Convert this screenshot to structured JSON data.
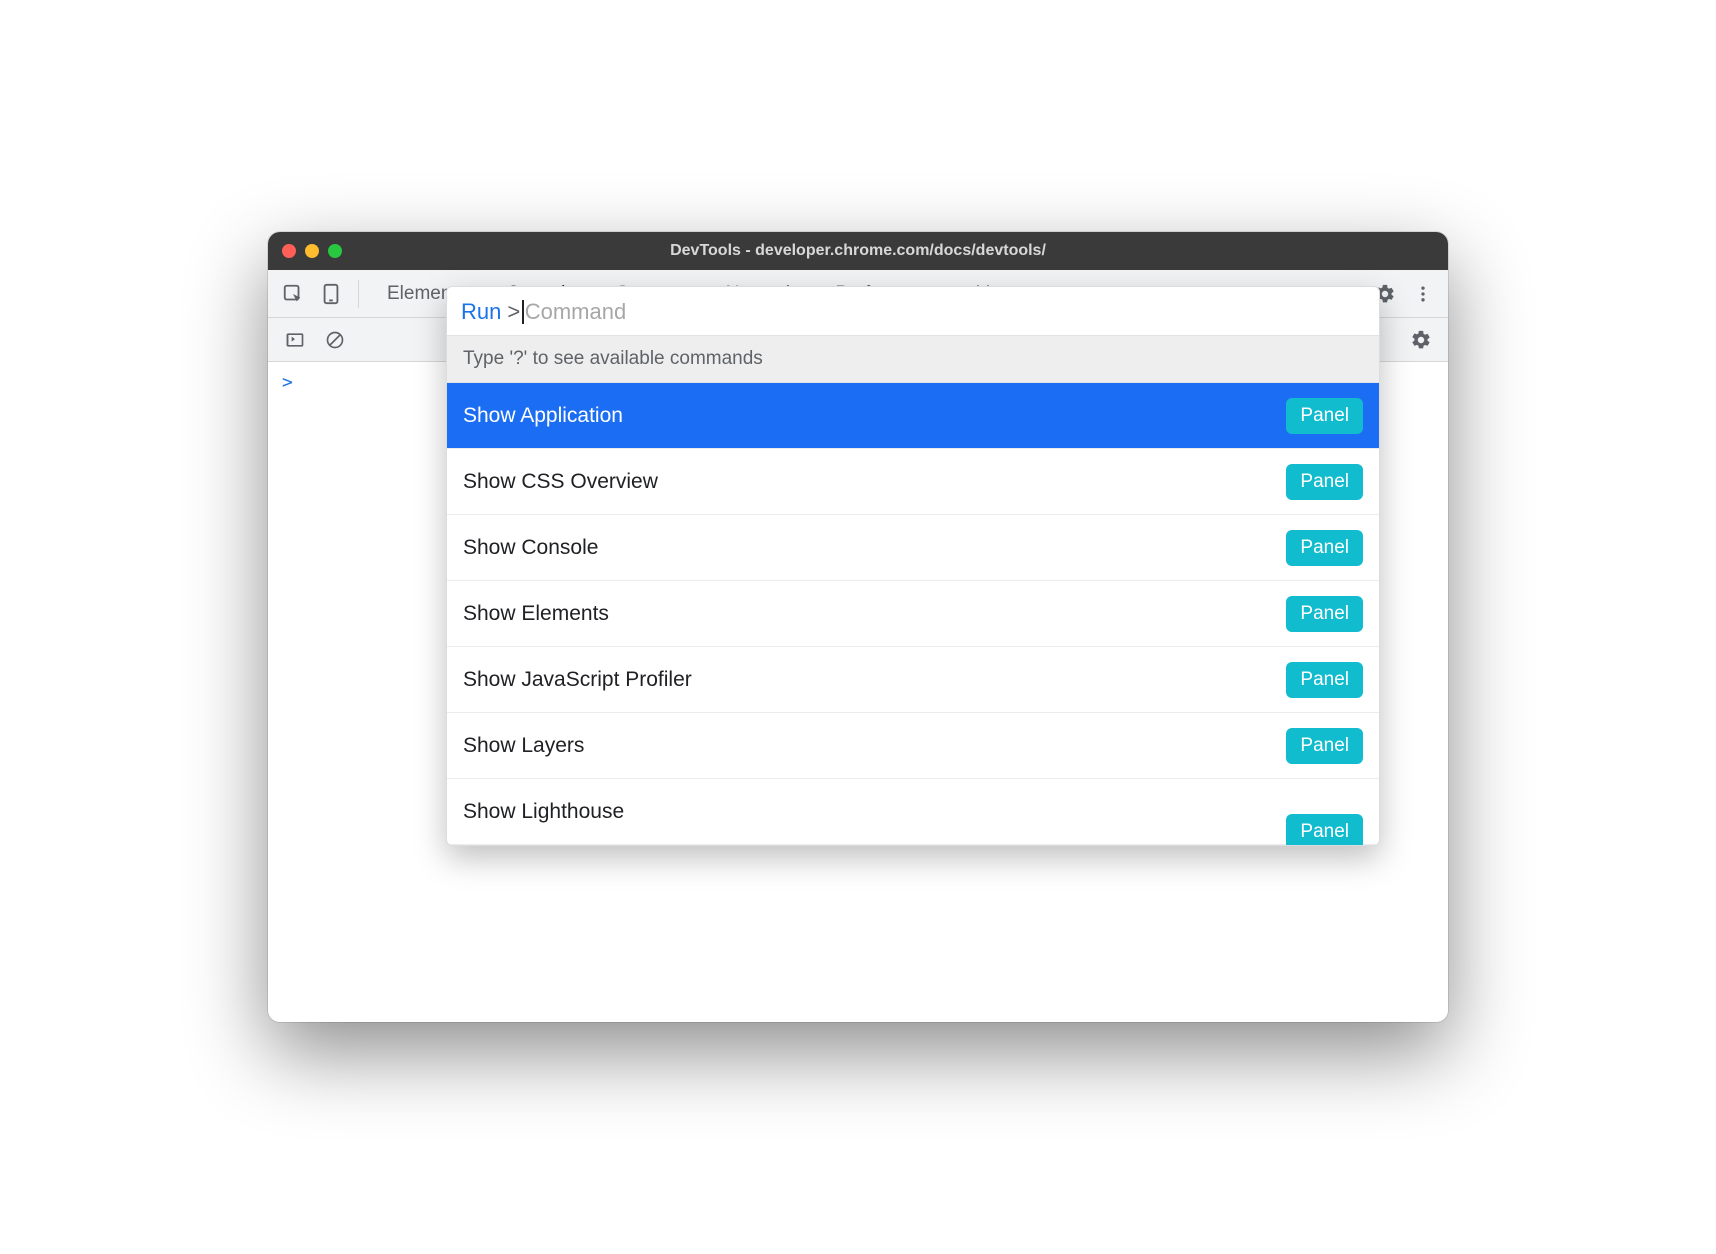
{
  "window": {
    "title": "DevTools - developer.chrome.com/docs/devtools/"
  },
  "tabs": {
    "items": [
      "Elements",
      "Console",
      "Sources",
      "Network",
      "Performance"
    ],
    "active_index": 1
  },
  "command_menu": {
    "prefix": "Run",
    "caret": ">",
    "placeholder": "Command",
    "hint": "Type '?' to see available commands",
    "badge_label": "Panel",
    "items": [
      {
        "label": "Show Application",
        "badge": "Panel",
        "selected": true
      },
      {
        "label": "Show CSS Overview",
        "badge": "Panel",
        "selected": false
      },
      {
        "label": "Show Console",
        "badge": "Panel",
        "selected": false
      },
      {
        "label": "Show Elements",
        "badge": "Panel",
        "selected": false
      },
      {
        "label": "Show JavaScript Profiler",
        "badge": "Panel",
        "selected": false
      },
      {
        "label": "Show Layers",
        "badge": "Panel",
        "selected": false
      },
      {
        "label": "Show Lighthouse",
        "badge": "Panel",
        "selected": false
      }
    ]
  },
  "console": {
    "prompt": ">"
  }
}
